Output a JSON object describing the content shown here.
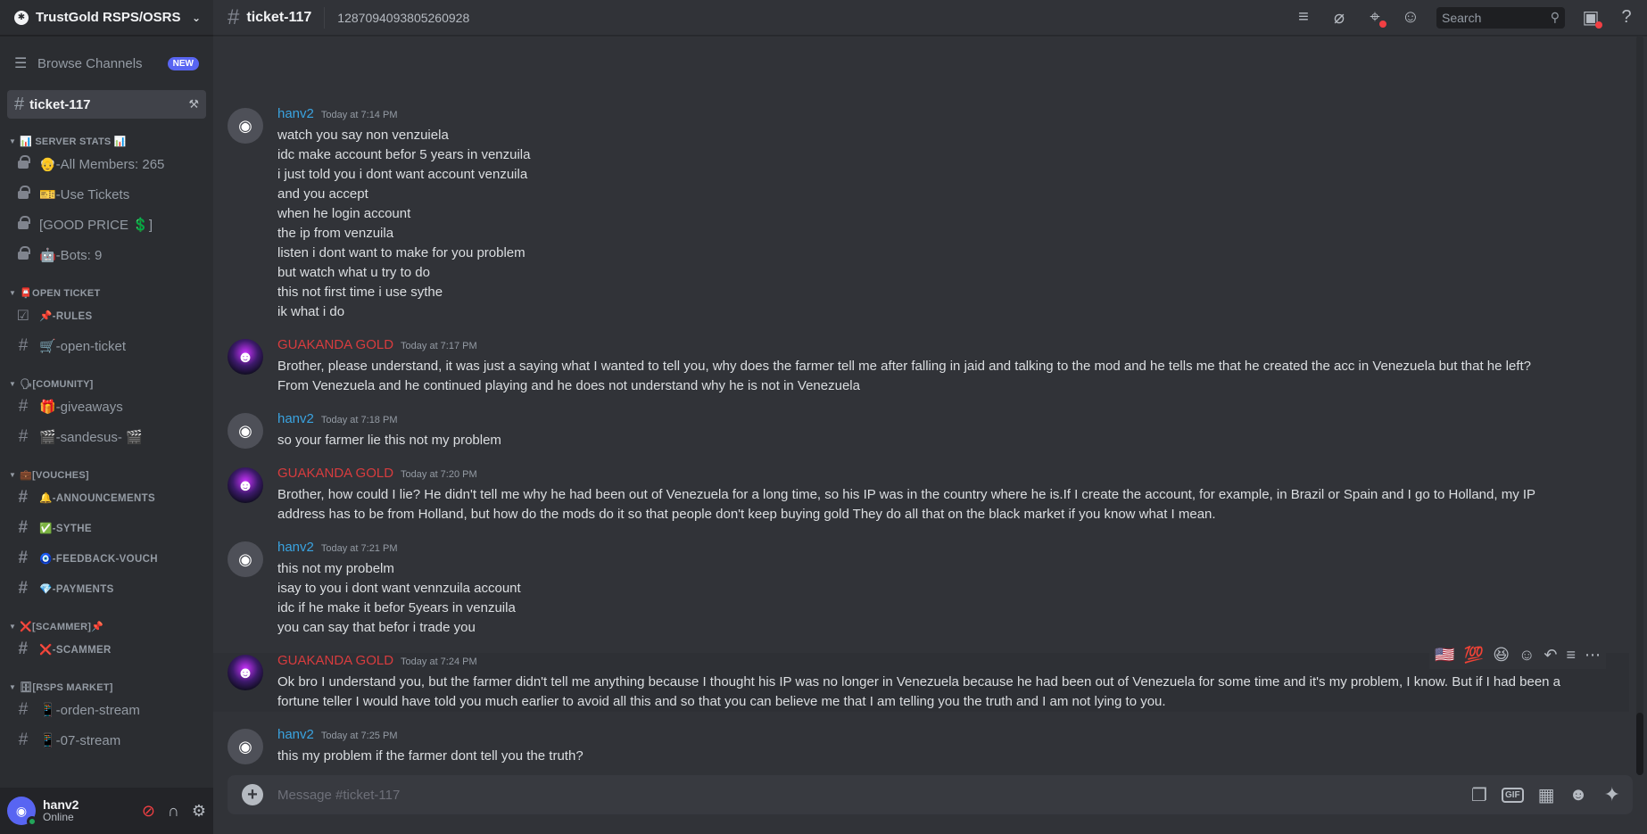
{
  "server": {
    "name": "TrustGold RSPS/OSRS"
  },
  "sidebar": {
    "browse_label": "Browse Channels",
    "browse_badge": "NEW",
    "selected_channel": "ticket-117",
    "categories": [
      {
        "name": "📊 SERVER STATS 📊",
        "channels": [
          {
            "label": "👴-All Members: 265",
            "locked": true
          },
          {
            "label": "🎫-Use Tickets",
            "locked": true
          },
          {
            "label": "[GOOD PRICE 💲]",
            "locked": true
          },
          {
            "label": "🤖-Bots: 9",
            "locked": true
          }
        ]
      },
      {
        "name": "📮OPEN TICKET",
        "channels": [
          {
            "label": "📌-RULES",
            "icon": "rules-icon",
            "small": true
          },
          {
            "label": "🛒-open-ticket",
            "icon": "hash"
          }
        ]
      },
      {
        "name": "🗣[COMUNITY]",
        "channels": [
          {
            "label": "🎁-giveaways",
            "icon": "hash"
          },
          {
            "label": "🎬-sandesus- 🎬",
            "icon": "hash"
          }
        ]
      },
      {
        "name": "💼[VOUCHES]",
        "channels": [
          {
            "label": "🔔-ANNOUNCEMENTS",
            "icon": "hash",
            "small": true
          },
          {
            "label": "✅-SYTHE",
            "icon": "hash",
            "small": true
          },
          {
            "label": "🧿-FEEDBACK-VOUCH",
            "icon": "hash",
            "small": true
          },
          {
            "label": "💎-PAYMENTS",
            "icon": "hash",
            "small": true
          }
        ]
      },
      {
        "name": "❌[SCAMMER]📌",
        "channels": [
          {
            "label": "❌-SCAMMER",
            "icon": "hash",
            "small": true
          }
        ]
      },
      {
        "name": "🗄[RSPS MARKET]",
        "channels": [
          {
            "label": "📱-orden-stream",
            "icon": "hash"
          },
          {
            "label": "📱-07-stream",
            "icon": "hash"
          }
        ]
      }
    ]
  },
  "user": {
    "name": "hanv2",
    "status": "Online"
  },
  "topbar": {
    "channel": "ticket-117",
    "topic": "1287094093805260928",
    "search_placeholder": "Search"
  },
  "messages": [
    {
      "author": "hanv2",
      "role": "hanv",
      "time": "Today at 7:14 PM",
      "lines": [
        "watch you say non venzuiela",
        "idc make account befor 5 years in venzuila",
        "i just told you i dont want account venzuila",
        "and you accept",
        "when he login account",
        "the ip from venzuila",
        "listen i dont want to make for you problem",
        "but watch what u try to do",
        "this not first time i use sythe",
        "ik what i do"
      ]
    },
    {
      "author": "GUAKANDA GOLD",
      "role": "guak",
      "time": "Today at 7:17 PM",
      "lines": [
        "Brother, please understand, it was just a saying what I wanted to tell you, why does the farmer tell me after falling in jaid and talking to the mod and he tells me that he created the acc in Venezuela but that he left?",
        "From Venezuela and he continued playing and he does not understand why he is not in Venezuela"
      ]
    },
    {
      "author": "hanv2",
      "role": "hanv",
      "time": "Today at 7:18 PM",
      "lines": [
        "so your farmer lie this not my problem"
      ]
    },
    {
      "author": "GUAKANDA GOLD",
      "role": "guak",
      "time": "Today at 7:20 PM",
      "lines": [
        "Brother, how could I lie? He didn't tell me why he had been out of Venezuela for a long time, so his IP was in the country where he is.If I create the account, for example, in Brazil or Spain and I go to Holland, my IP",
        "address has to be from Holland, but how do the mods do it so that people don't keep buying gold They do all that on the black market if you know what I mean."
      ]
    },
    {
      "author": "hanv2",
      "role": "hanv",
      "time": "Today at 7:21 PM",
      "lines": [
        "this not my probelm",
        "isay to you i dont want vennzuila account",
        "idc if he make it befor 5years in venzuila",
        "you can say that befor i trade you"
      ]
    },
    {
      "author": "GUAKANDA GOLD",
      "role": "guak",
      "time": "Today at 7:24 PM",
      "hover": true,
      "lines": [
        "Ok bro I understand you, but the farmer didn't tell me anything because I thought his IP was no longer in Venezuela because he had been out of Venezuela for some time and it's my problem, I know. But if I had been a",
        "fortune teller I would have told you much earlier to avoid all this and so that you can believe me that I am telling you the truth and I am not lying to you."
      ]
    },
    {
      "author": "hanv2",
      "role": "hanv",
      "time": "Today at 7:25 PM",
      "lines": [
        "this my problem if the farmer dont tell you the truth?"
      ]
    }
  ],
  "hover_reactions": [
    "🇺🇸",
    "💯",
    "😆"
  ],
  "composer": {
    "placeholder": "Message #ticket-117"
  }
}
